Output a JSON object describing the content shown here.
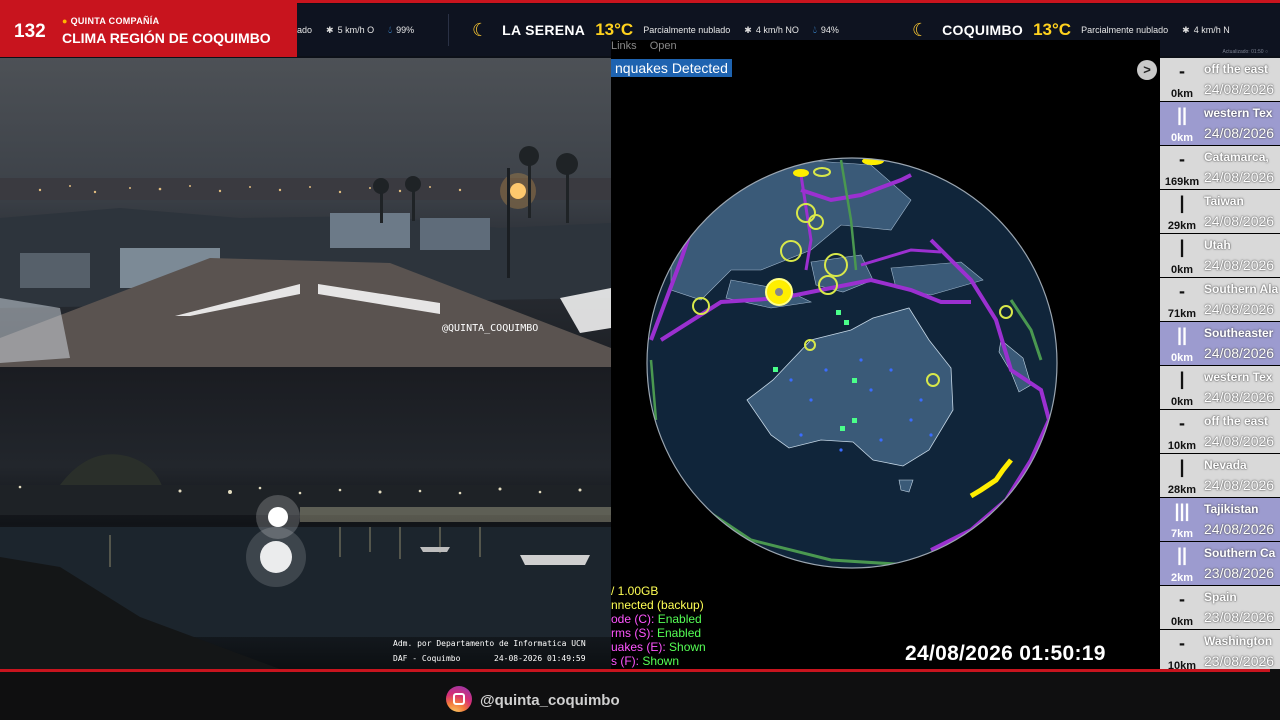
{
  "header": {
    "brand_number": "132",
    "brand_subtitle": "QUINTA COMPAÑÍA",
    "brand_title": "CLIMA REGIÓN DE COQUIMBO",
    "updated": "Actualizado: 01:50 ○",
    "ticker_prev": {
      "prefix": "ado",
      "wind": "5 km/h O",
      "humidity": "99%"
    },
    "ticker": [
      {
        "city": "LA SERENA",
        "temp": "13°C",
        "condition": "Parcialmente nublado",
        "wind": "4 km/h NO",
        "humidity": "94%"
      },
      {
        "city": "COQUIMBO",
        "temp": "13°C",
        "condition": "Parcialmente nublado",
        "wind": "4 km/h N",
        "humidity": ""
      }
    ]
  },
  "cameras": {
    "cam1_watermark": "@QUINTA_COQUIMBO",
    "cam2_caption_line1": "Adm. por Departamento de Informatica UCN",
    "cam2_caption_line2": "DAF - Coquimbo",
    "cam2_timestamp": "24-08-2026 01:49:59"
  },
  "quake_monitor": {
    "menu": [
      "Links",
      "Open"
    ],
    "detected_label": "nquakes Detected",
    "arrow_label": ">",
    "stats": [
      {
        "text": "/ 1.00GB",
        "color": "y"
      },
      {
        "text": "nnected (backup)",
        "color": "y"
      },
      {
        "text": "ode (C): ",
        "value": "Enabled",
        "color": "m"
      },
      {
        "text": "rms (S): ",
        "value": "Enabled",
        "color": "m"
      },
      {
        "text": "uakes (E): ",
        "value": "Shown",
        "color": "m"
      },
      {
        "text": "s (F): ",
        "value": "Shown",
        "color": "m"
      }
    ],
    "datetime": "24/08/2026 01:50:19"
  },
  "quake_list": [
    {
      "bars": "-",
      "depth": "0km",
      "place": "off the east",
      "date": "24/08/2026",
      "highlight": false
    },
    {
      "bars": "||",
      "depth": "0km",
      "place": "western Tex",
      "date": "24/08/2026",
      "highlight": true
    },
    {
      "bars": "-",
      "depth": "169km",
      "place": "Catamarca,",
      "date": "24/08/2026",
      "highlight": false
    },
    {
      "bars": "|",
      "depth": "29km",
      "place": "Taiwan",
      "date": "24/08/2026",
      "highlight": false
    },
    {
      "bars": "|",
      "depth": "0km",
      "place": "Utah",
      "date": "24/08/2026",
      "highlight": false
    },
    {
      "bars": "-",
      "depth": "71km",
      "place": "Southern Ala",
      "date": "24/08/2026",
      "highlight": false
    },
    {
      "bars": "||",
      "depth": "0km",
      "place": "Southeaster",
      "date": "24/08/2026",
      "highlight": true
    },
    {
      "bars": "|",
      "depth": "0km",
      "place": "western Tex",
      "date": "24/08/2026",
      "highlight": false
    },
    {
      "bars": "-",
      "depth": "10km",
      "place": "off the east",
      "date": "24/08/2026",
      "highlight": false
    },
    {
      "bars": "|",
      "depth": "28km",
      "place": "Nevada",
      "date": "24/08/2026",
      "highlight": false
    },
    {
      "bars": "|||",
      "depth": "7km",
      "place": "Tajikistan",
      "date": "24/08/2026",
      "highlight": true
    },
    {
      "bars": "||",
      "depth": "2km",
      "place": "Southern Ca",
      "date": "23/08/2026",
      "highlight": true
    },
    {
      "bars": "-",
      "depth": "0km",
      "place": "Spain",
      "date": "23/08/2026",
      "highlight": false
    },
    {
      "bars": "-",
      "depth": "10km",
      "place": "Washington",
      "date": "23/08/2026",
      "highlight": false
    }
  ],
  "footer": {
    "instagram_handle": "@quinta_coquimbo",
    "icon": "instagram-icon"
  },
  "colors": {
    "brand_red": "#c8141e",
    "temp_yellow": "#ffd21e",
    "detected_blue": "#1e63b0",
    "list_highlight": "#9c9bcf",
    "list_normal": "#d9d9d9"
  }
}
